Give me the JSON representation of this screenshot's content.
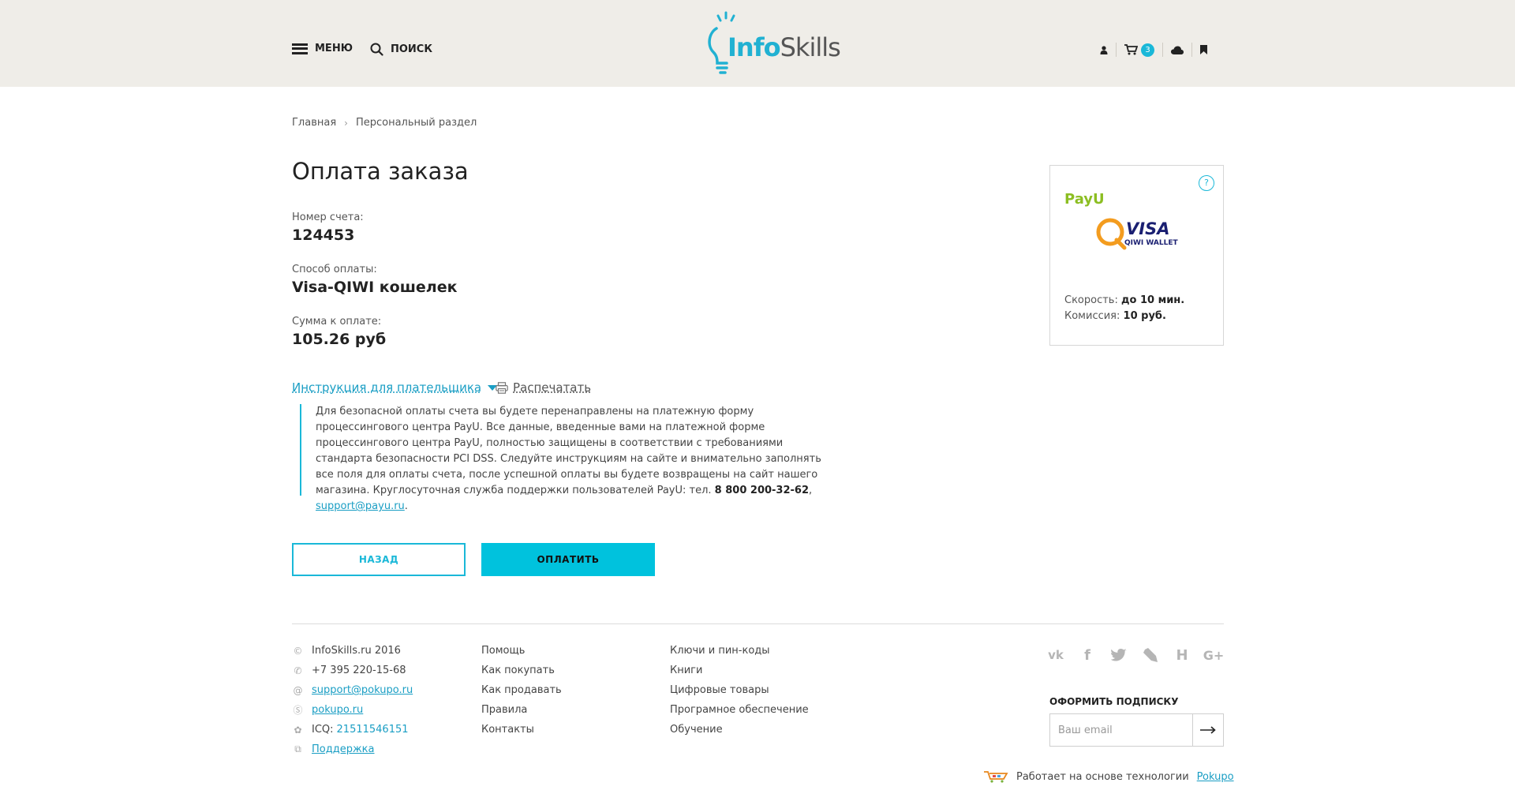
{
  "header": {
    "menu_label": "МЕНЮ",
    "search_label": "ПОИСК",
    "logo_part1": "Info",
    "logo_part2": "Skills",
    "cart_count": "3",
    "accent": "#1ab8d8"
  },
  "breadcrumb": {
    "home": "Главная",
    "current": "Персональный раздел"
  },
  "main": {
    "title": "Оплата заказа",
    "invoice_label": "Номер счета:",
    "invoice_value": "124453",
    "method_label": "Способ оплаты:",
    "method_value": "Visa-QIWI кошелек",
    "amount_label": "Сумма к оплате:",
    "amount_value": "105.26 руб",
    "instructions_toggle": "Инструкция для плательщика",
    "print_label": "Распечатать",
    "instructions_text": "Для безопасной оплаты счета вы будете перенаправлены на платежную форму процессингового центра PayU. Все данные, введенные вами на платежной форме процессингового центра PayU, полностью защищены в соответствии с требованиями стандарта безопасности PCI DSS. Следуйте инструкциям на сайте и внимательно заполнять все поля для оплаты счета, после успешной оплаты вы будете возвращены на сайт нашего магазина. Круглосуточная служба поддержки пользователей PayU: тел.",
    "instructions_phone": "8 800 200-32-62",
    "instructions_email": "support@payu.ru",
    "back_button": "НАЗАД",
    "pay_button": "ОПЛАТИТЬ"
  },
  "payment_card": {
    "help": "?",
    "provider": "PayU",
    "wallet_brand": "VISA",
    "wallet_name": "QIWI WALLET",
    "speed_label": "Скорость:",
    "speed_value": "до 10 мин.",
    "fee_label": "Комиссия:",
    "fee_value": "10 руб."
  },
  "footer": {
    "contacts": {
      "copyright": "InfoSkills.ru 2016",
      "phone": "+7 395 220-15-68",
      "email": "support@pokupo.ru",
      "skype": "pokupo.ru",
      "icq_label": "ICQ:",
      "icq_value": "21511546151",
      "support": "Поддержка"
    },
    "col2": [
      "Помощь",
      "Как покупать",
      "Как продавать",
      "Правила",
      "Контакты"
    ],
    "col3": [
      "Ключи и пин-коды",
      "Книги",
      "Цифровые товары",
      "Програмное обеспечение",
      "Обучение"
    ],
    "socials": [
      "vk-icon",
      "facebook-icon",
      "twitter-icon",
      "livejournal-icon",
      "habr-icon",
      "google-plus-icon"
    ],
    "subscribe_title": "ОФОРМИТЬ ПОДПИСКУ",
    "subscribe_placeholder": "Ваш email",
    "powered_text": "Работает на основе технологии",
    "powered_link": "Pokupo"
  }
}
